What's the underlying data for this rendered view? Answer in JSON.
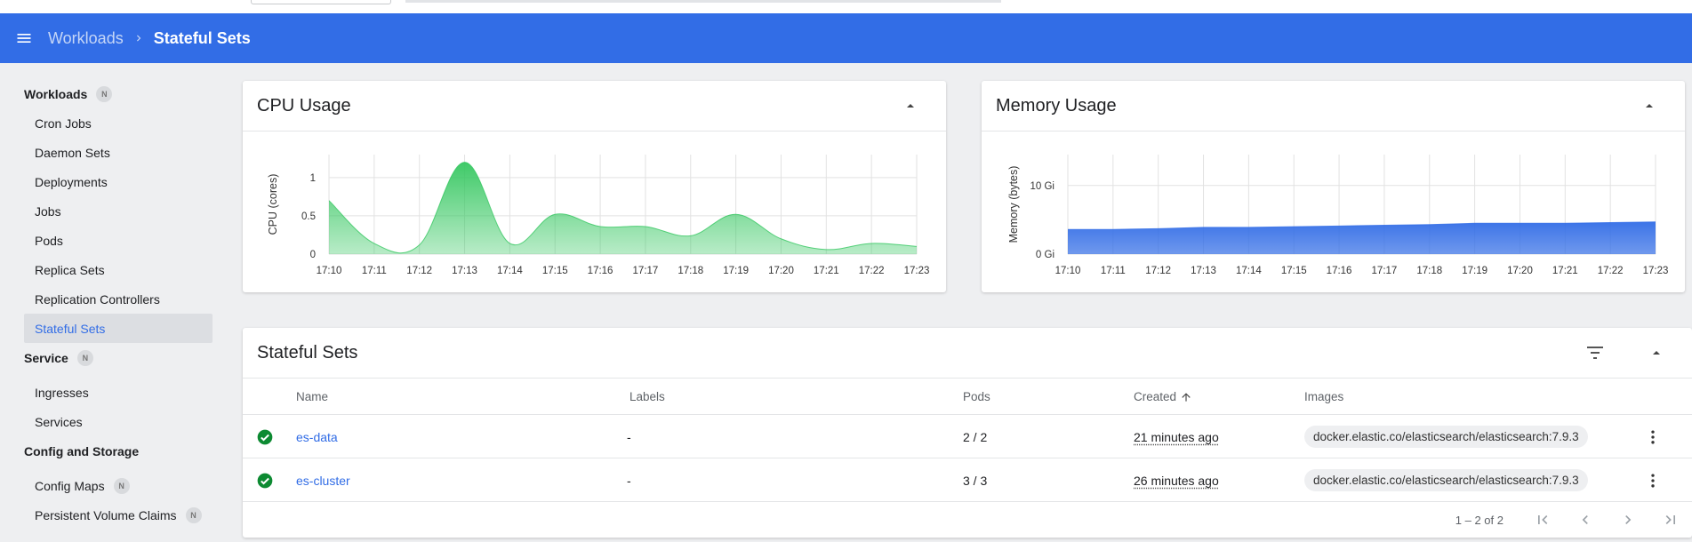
{
  "header": {
    "breadcrumb_parent": "Workloads",
    "breadcrumb_current": "Stateful Sets"
  },
  "sidebar": {
    "sections": [
      {
        "label": "Workloads",
        "badge": "N"
      },
      {
        "label": "Service",
        "badge": "N"
      },
      {
        "label": "Config and Storage"
      }
    ],
    "workloads_items": [
      "Cron Jobs",
      "Daemon Sets",
      "Deployments",
      "Jobs",
      "Pods",
      "Replica Sets",
      "Replication Controllers",
      "Stateful Sets"
    ],
    "active_item": "Stateful Sets",
    "service_items": [
      "Ingresses",
      "Services"
    ],
    "config_items": [
      {
        "label": "Config Maps",
        "badge": "N"
      },
      {
        "label": "Persistent Volume Claims",
        "badge": "N"
      }
    ]
  },
  "cpu_card": {
    "title": "CPU Usage"
  },
  "memory_card": {
    "title": "Memory Usage"
  },
  "chart_data": [
    {
      "type": "area",
      "title": "CPU Usage",
      "ylabel": "CPU (cores)",
      "xlabel": "",
      "x": [
        "17:10",
        "17:11",
        "17:12",
        "17:13",
        "17:14",
        "17:15",
        "17:16",
        "17:17",
        "17:18",
        "17:19",
        "17:20",
        "17:21",
        "17:22",
        "17:23"
      ],
      "yticks": [
        "0",
        "0.5",
        "1"
      ],
      "ylim": [
        0,
        1.3
      ],
      "series": [
        {
          "values": [
            0.7,
            0.14,
            0.12,
            1.2,
            0.14,
            0.52,
            0.36,
            0.36,
            0.24,
            0.52,
            0.2,
            0.06,
            0.14,
            0.1
          ]
        }
      ],
      "color": "#35c760",
      "grid": true
    },
    {
      "type": "area",
      "title": "Memory Usage",
      "ylabel": "Memory (bytes)",
      "xlabel": "",
      "x": [
        "17:10",
        "17:11",
        "17:12",
        "17:13",
        "17:14",
        "17:15",
        "17:16",
        "17:17",
        "17:18",
        "17:19",
        "17:20",
        "17:21",
        "17:22",
        "17:23"
      ],
      "yticks": [
        "0 Gi",
        "10 Gi"
      ],
      "ylim": [
        0,
        14.5
      ],
      "series": [
        {
          "values": [
            3.6,
            3.6,
            3.7,
            3.9,
            3.9,
            4.0,
            4.1,
            4.2,
            4.3,
            4.5,
            4.5,
            4.5,
            4.6,
            4.7
          ]
        }
      ],
      "color": "#326de6",
      "grid": true
    }
  ],
  "table": {
    "title": "Stateful Sets",
    "columns": [
      "Name",
      "Labels",
      "Pods",
      "Created",
      "Images"
    ],
    "rows": [
      {
        "name": "es-data",
        "labels": "-",
        "pods": "2 / 2",
        "created": "21 minutes ago",
        "image": "docker.elastic.co/elasticsearch/elasticsearch:7.9.3",
        "status": "ok"
      },
      {
        "name": "es-cluster",
        "labels": "-",
        "pods": "3 / 3",
        "created": "26 minutes ago",
        "image": "docker.elastic.co/elasticsearch/elasticsearch:7.9.3",
        "status": "ok"
      }
    ],
    "range_label": "1 – 2 of 2"
  },
  "icons": {
    "menu": "menu-icon",
    "breadcrumb_sep": "chevron-right-icon",
    "collapse": "chevron-up-icon",
    "filter": "filter-list-icon",
    "status": "check-circle-icon",
    "row_menu": "more-vert-icon",
    "sort": "arrow-up-icon"
  },
  "colors": {
    "primary": "#326de6",
    "success": "#0d8a32",
    "cpu_fill": "#35c760",
    "memory_fill": "#326de6"
  }
}
